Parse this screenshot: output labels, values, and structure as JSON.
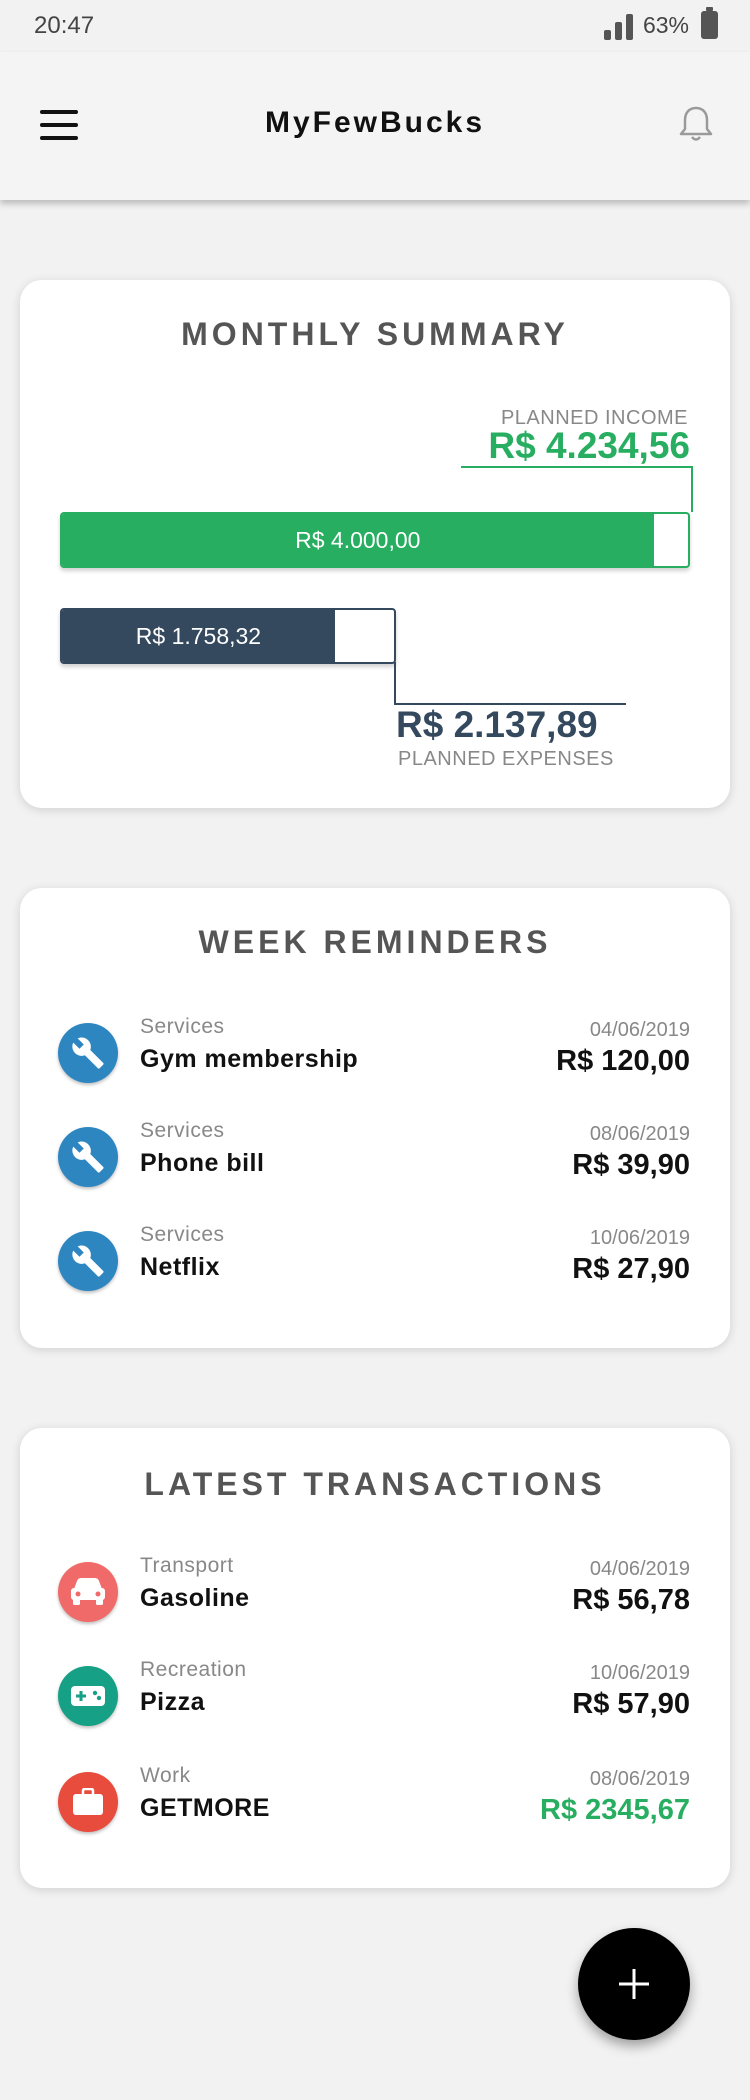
{
  "status_bar": {
    "time": "20:47",
    "battery": "63%"
  },
  "app_bar": {
    "title": "MyFewBucks"
  },
  "summary": {
    "title": "MONTHLY SUMMARY",
    "planned_income_label": "PLANNED INCOME",
    "planned_income_value": "R$ 4.234,56",
    "income_actual": "R$ 4.000,00",
    "income_fraction": 0.945,
    "expenses_actual": "R$ 1.758,32",
    "expenses_fraction": 0.822,
    "planned_expenses_value": "R$ 2.137,89",
    "planned_expenses_label": "PLANNED EXPENSES"
  },
  "reminders": {
    "title": "WEEK REMINDERS",
    "items": [
      {
        "category": "Services",
        "name": "Gym membership",
        "date": "04/06/2019",
        "amount": "R$ 120,00"
      },
      {
        "category": "Services",
        "name": "Phone bill",
        "date": "08/06/2019",
        "amount": "R$ 39,90"
      },
      {
        "category": "Services",
        "name": "Netflix",
        "date": "10/06/2019",
        "amount": "R$ 27,90"
      }
    ]
  },
  "transactions": {
    "title": "LATEST TRANSACTIONS",
    "items": [
      {
        "category": "Transport",
        "name": "Gasoline",
        "date": "04/06/2019",
        "amount": "R$ 56,78",
        "icon": "car-icon",
        "color": "#f06a6a"
      },
      {
        "category": "Recreation",
        "name": "Pizza",
        "date": "10/06/2019",
        "amount": "R$ 57,90",
        "icon": "gamepad-icon",
        "color": "#16a085"
      },
      {
        "category": "Work",
        "name": "GETMORE",
        "date": "08/06/2019",
        "amount": "R$ 2345,67",
        "icon": "briefcase-icon",
        "color": "#e74c3c"
      }
    ]
  },
  "colors": {
    "income": "#27ae60",
    "expenses": "#34495e",
    "services": "#2e86c1"
  }
}
